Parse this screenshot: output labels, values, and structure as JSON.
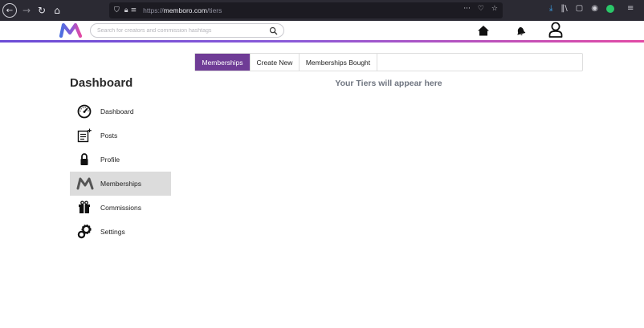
{
  "browser": {
    "url_prefix": "https://",
    "url_domain": "memboro.com",
    "url_path": "/tiers",
    "more_glyph": "···"
  },
  "header": {
    "search_placeholder": "Search for creators and commission hashtags",
    "brand_gradient": [
      "#4b6fe0",
      "#8a5ad8",
      "#e24aa5"
    ]
  },
  "sidebar": {
    "title": "Dashboard",
    "items": [
      {
        "label": "Dashboard",
        "icon": "speedometer-icon"
      },
      {
        "label": "Posts",
        "icon": "add-post-icon"
      },
      {
        "label": "Profile",
        "icon": "lock-icon"
      },
      {
        "label": "Memberships",
        "icon": "memboro-m-icon",
        "active": true
      },
      {
        "label": "Commissions",
        "icon": "gift-icon"
      },
      {
        "label": "Settings",
        "icon": "gears-icon"
      }
    ]
  },
  "main": {
    "tabs": [
      {
        "label": "Memberships",
        "active": true
      },
      {
        "label": "Create New",
        "active": false
      },
      {
        "label": "Memberships Bought",
        "active": false
      }
    ],
    "empty_message": "Your Tiers will appear here"
  },
  "colors": {
    "active_tab": "#6f3c96",
    "active_sidebar": "#dcdcdc",
    "empty_text": "#6f7580"
  }
}
